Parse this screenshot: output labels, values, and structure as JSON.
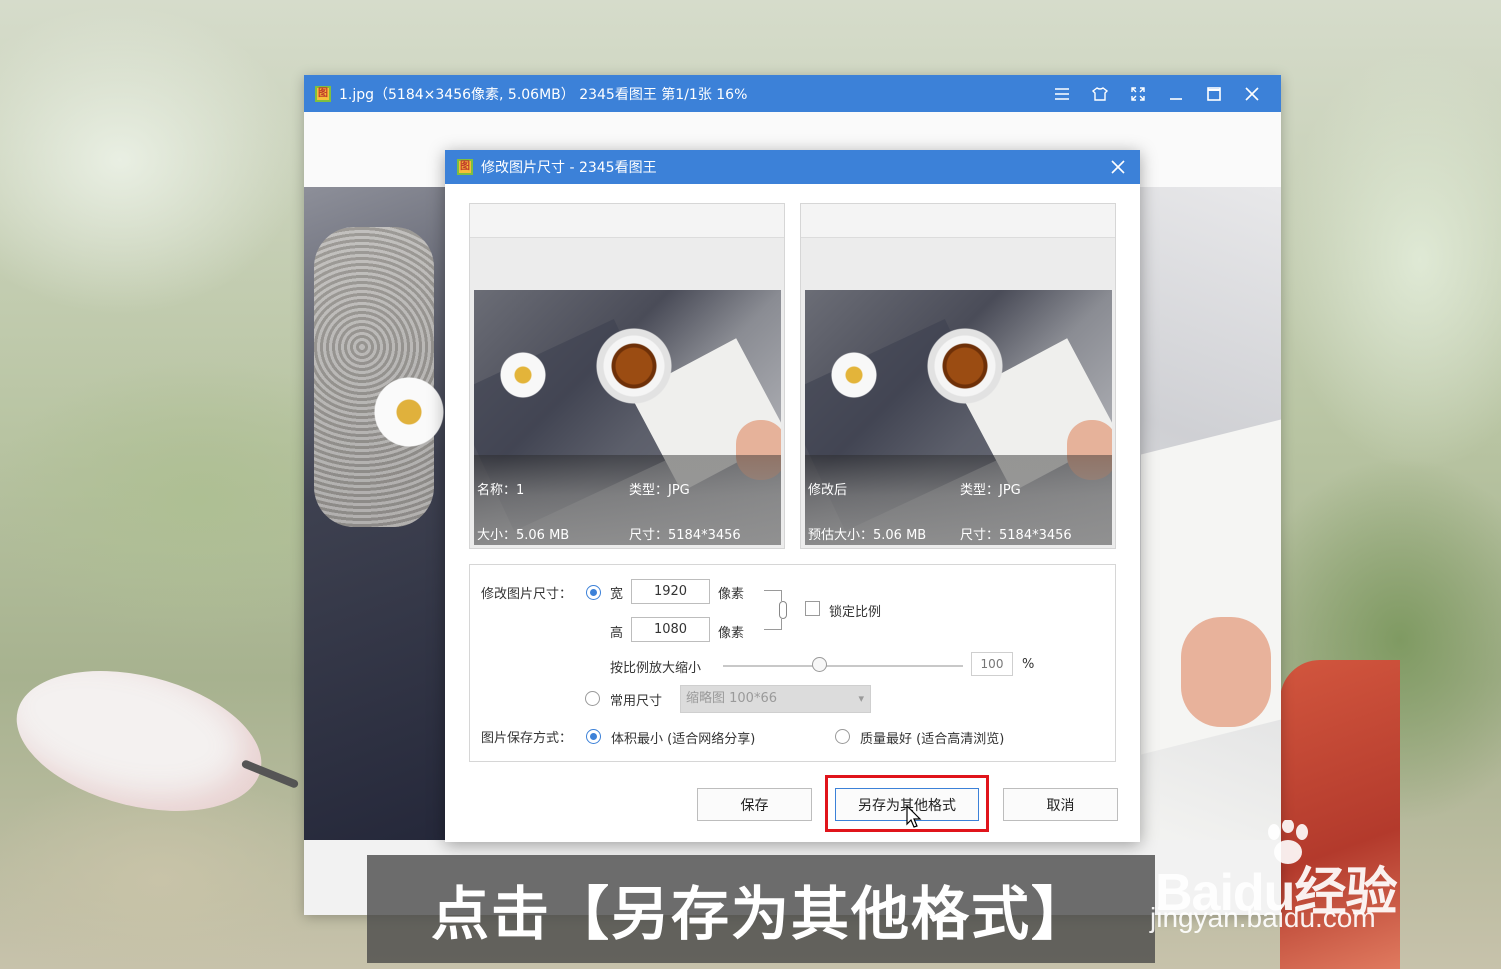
{
  "viewer": {
    "title": "1.jpg（5184×3456像素, 5.06MB） 2345看图王 第1/1张 16%",
    "logo_char": "图"
  },
  "dialog": {
    "title": "修改图片尺寸 - 2345看图王",
    "logo_char": "图",
    "original": {
      "name": "名称：1",
      "type": "类型：JPG",
      "size": "大小：5.06 MB",
      "dimensions": "尺寸：5184*3456"
    },
    "modified": {
      "name": "修改后",
      "type": "类型：JPG",
      "size": "预估大小：5.06 MB",
      "dimensions": "尺寸：5184*3456"
    },
    "settings": {
      "resize_label": "修改图片尺寸：",
      "width_label": "宽",
      "width_value": "1920",
      "width_unit": "像素",
      "height_label": "高",
      "height_value": "1080",
      "height_unit": "像素",
      "lock_ratio_label": "锁定比例",
      "lock_ratio_checked": false,
      "scale_label": "按比例放大缩小",
      "scale_value": "100",
      "scale_unit": "%",
      "scale_slider_percent": 40,
      "common_size_label": "常用尺寸",
      "common_size_selected": "缩略图 100*66",
      "save_mode_label": "图片保存方式：",
      "save_mode_small": "体积最小 (适合网络分享)",
      "save_mode_quality": "质量最好 (适合高清浏览)"
    },
    "buttons": {
      "save": "保存",
      "save_as_other": "另存为其他格式",
      "cancel": "取消"
    }
  },
  "caption": "点击【另存为其他格式】",
  "watermark": {
    "brand": "Baidu经验",
    "url": "jingyan.baidu.com"
  },
  "colors": {
    "titlebar": "#3c81d8",
    "highlight": "#e0141b"
  }
}
